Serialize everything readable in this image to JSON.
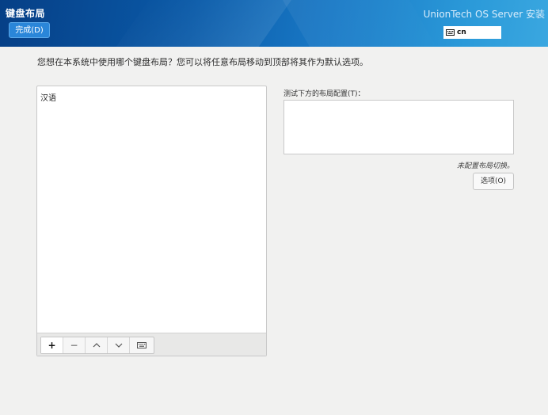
{
  "header": {
    "title": "键盘布局",
    "done_label": "完成(D)",
    "product": "UnionTech OS Server 安装",
    "current_layout": "cn",
    "current_layout_icon": "keyboard-icon"
  },
  "main": {
    "instruction": "您想在本系统中使用哪个键盘布局？您可以将任意布局移动到顶部将其作为默认选项。",
    "layouts": [
      "汉语"
    ],
    "toolbar": {
      "add": "+",
      "remove": "−",
      "up": "⌃",
      "down": "⌄",
      "preview_icon": "keyboard-icon"
    },
    "test_label": "测试下方的布局配置(T)：",
    "test_value": "",
    "switch_note": "未配置布局切换。",
    "options_label": "选项(O)"
  },
  "colors": {
    "header_dark": "#063f86",
    "header_light": "#3aa7e0",
    "done_button": "#2a86d9",
    "background": "#f1f1f0"
  }
}
